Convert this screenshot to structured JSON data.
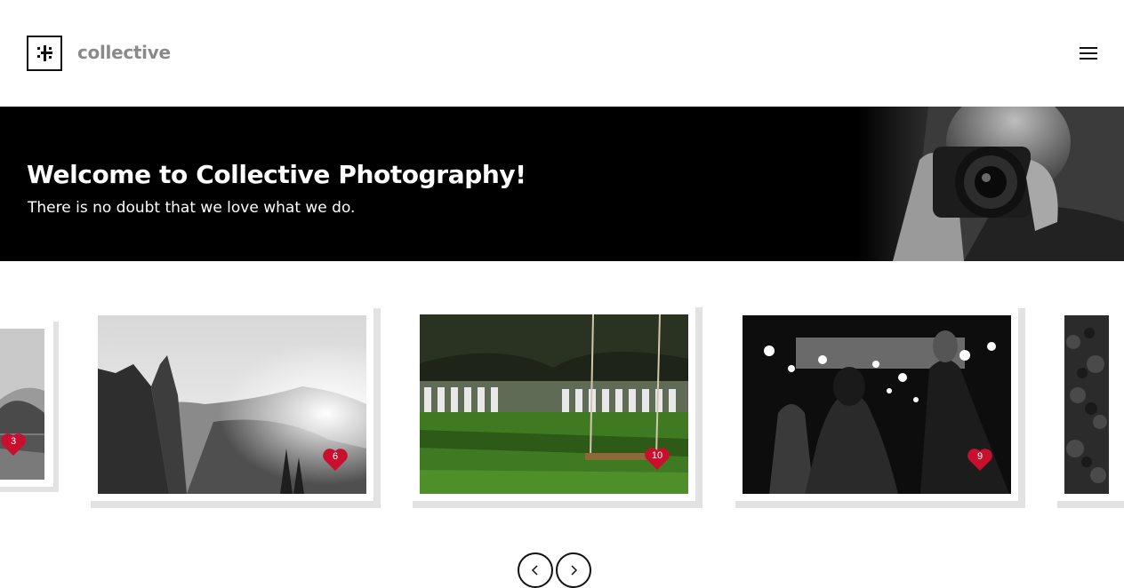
{
  "brand": {
    "name": "collective",
    "logo_icon": "hashtag-logo-icon"
  },
  "header": {
    "menu_icon": "hamburger-menu-icon"
  },
  "hero": {
    "title": "Welcome to Collective Photography!",
    "subtitle": "There is no doubt that we love what we do.",
    "image": "photographer-with-nikon-camera"
  },
  "gallery": {
    "items": [
      {
        "subject": "black-and-white-mountain-lake",
        "likes": "3"
      },
      {
        "subject": "black-and-white-yosemite-valley",
        "likes": "6"
      },
      {
        "subject": "wooden-swing-in-wedding-garden",
        "likes": "10"
      },
      {
        "subject": "black-and-white-sparkler-wedding-exit",
        "likes": "9"
      },
      {
        "subject": "black-and-white-foliage",
        "likes": ""
      }
    ],
    "like_icon": "heart-icon",
    "prev_icon": "chevron-left-icon",
    "next_icon": "chevron-right-icon"
  },
  "colors": {
    "accent_heart": "#c8102e",
    "hero_bg": "#000000",
    "brand_text": "#8a8a8a"
  }
}
